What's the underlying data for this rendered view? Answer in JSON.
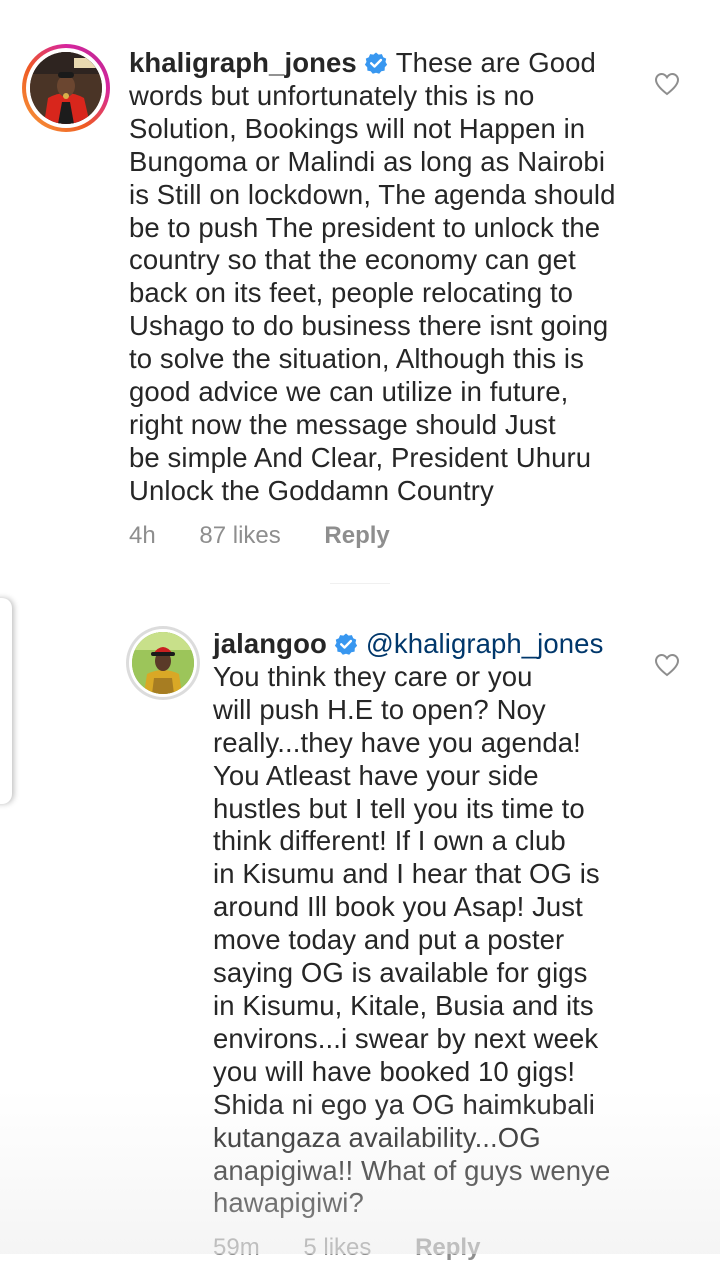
{
  "comments": [
    {
      "username": "khaligraph_jones",
      "verified": true,
      "lines": [
        "These are Good",
        "words but unfortunately this is no",
        "Solution, Bookings will not Happen in",
        "Bungoma or Malindi as long as Nairobi",
        "is Still on lockdown, The agenda should",
        "be to push The president to unlock the",
        "country so that the economy can get",
        "back on its feet, people relocating to",
        "Ushago to do business there isnt going",
        "to solve the situation, Although this is",
        "good advice we can utilize in future,",
        "right now the message should Just",
        "be simple And Clear, President Uhuru",
        "Unlock the Goddamn Country"
      ],
      "time": "4h",
      "likes": "87 likes",
      "reply_label": "Reply",
      "avatar_icon": "profile-photo",
      "like_icon": "heart-outline-icon"
    },
    {
      "username": "jalangoo",
      "verified": true,
      "mention": "@khaligraph_jones",
      "lines": [
        "You think they care or you",
        "will push H.E to open? Noy",
        "really...they have you agenda!",
        "You Atleast have your side",
        "hustles but I tell you its time to",
        "think different! If I own a club",
        "in Kisumu and I hear that OG is",
        "around Ill book you Asap! Just",
        "move today and put a poster",
        "saying OG is available for gigs",
        "in Kisumu, Kitale, Busia and its",
        "environs...i swear by next week",
        "you will have booked 10 gigs!",
        "Shida ni ego ya OG haimkubali",
        "kutangaza availability...OG",
        "anapigiwa!! What of guys wenye",
        "hawapigiwi?"
      ],
      "time": "59m",
      "likes": "5 likes",
      "reply_label": "Reply",
      "avatar_icon": "profile-photo",
      "like_icon": "heart-outline-icon"
    }
  ],
  "colors": {
    "text": "#262626",
    "meta": "#8e8e8e",
    "verified": "#3897f0",
    "mention": "#00376b",
    "story_ring_start": "#f9a03c",
    "story_ring_end": "#d6249f"
  }
}
